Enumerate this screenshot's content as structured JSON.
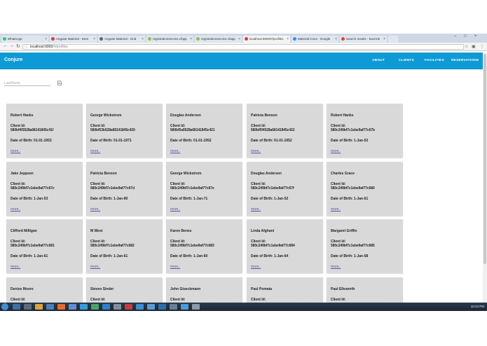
{
  "browser": {
    "tabs": [
      {
        "label": "WhatsApp",
        "color": "#25d366",
        "active": false
      },
      {
        "label": "Angular Material - Dem",
        "color": "#e53935",
        "active": false
      },
      {
        "label": "Angular Material - Grid",
        "color": "#666666",
        "active": false
      },
      {
        "label": "registrationservice.cfapp",
        "color": "#8bc34a",
        "active": false
      },
      {
        "label": "registrationservice.cfapp",
        "color": "#8bc34a",
        "active": false
      },
      {
        "label": "localhost:9000/#/profiles",
        "color": "#e53935",
        "active": true
      },
      {
        "label": "Material icons - Google",
        "color": "#4285f4",
        "active": false
      },
      {
        "label": "Search results - kuenzle",
        "color": "#ea4335",
        "active": false
      }
    ],
    "url_host": "localhost:9000",
    "url_path": "/#/profiles"
  },
  "app": {
    "brand": "Conjure",
    "nav": [
      "ABOUT",
      "CLIENTS",
      "FACILITIES",
      "RESERVATIONS"
    ]
  },
  "search": {
    "placeholder": "LastName"
  },
  "labels": {
    "client_id": "Client Id:",
    "dob_prefix": "Date of Birth: ",
    "more": "more.."
  },
  "profiles": [
    {
      "name": "Robert Hanks",
      "id": "580bf4f3528a68141845c41f",
      "dob": "01-01-1953"
    },
    {
      "name": "George Wickstrom",
      "id": "580bf53b528a68141845c420",
      "dob": "01-01-1971"
    },
    {
      "name": "Douglas Andersen",
      "id": "580bf5a9528a68141845c421",
      "dob": "01-01-1952"
    },
    {
      "name": "Patricia Benson",
      "id": "580bf5f4528a68141845c422",
      "dob": "01-01-1952"
    },
    {
      "name": "Robert Hanks",
      "id": "580c249bf7c1ebe9af77c67b",
      "dob": "1-Jan-53"
    },
    {
      "name": "Jake Jeppsen",
      "id": "580c249bf7c1ebe9af77c67c",
      "dob": "1-Jan-53"
    },
    {
      "name": "Patricia Benson",
      "id": "580c249bf7c1ebe9af77c67d",
      "dob": "1-Jan-80"
    },
    {
      "name": "George Wickstrom",
      "id": "580c249bf7c1ebe9af77c67e",
      "dob": "1-Jan-71"
    },
    {
      "name": "Douglas Andersen",
      "id": "580c249bf7c1ebe9af77c67f",
      "dob": "1-Jan-52"
    },
    {
      "name": "Charles Grace",
      "id": "580c249bf7c1ebe9af77c680",
      "dob": "1-Jan-61"
    },
    {
      "name": "Clifford Milligan",
      "id": "580c249bf7c1ebe9af77c681",
      "dob": "1-Jan-61"
    },
    {
      "name": "M West",
      "id": "580c249bf7c1ebe9af77c682",
      "dob": "1-Jan-61"
    },
    {
      "name": "Karen Benes",
      "id": "580c249bf7c1ebe9af77c683",
      "dob": "1-Jan-60"
    },
    {
      "name": "Linda Afghani",
      "id": "580c249bf7c1ebe9af77c684",
      "dob": "1-Jan-64"
    },
    {
      "name": "Margaret Griffin",
      "id": "580c249bf7c1ebe9af77c685",
      "dob": "1-Jan-58"
    },
    {
      "name": "Denise Moore",
      "id": "",
      "dob": ""
    },
    {
      "name": "Steven Sinder",
      "id": "",
      "dob": ""
    },
    {
      "name": "John Glueckmann",
      "id": "",
      "dob": ""
    },
    {
      "name": "Paul Pomata",
      "id": "",
      "dob": ""
    },
    {
      "name": "Paul Ellsworth",
      "id": "",
      "dob": ""
    }
  ],
  "taskbar": {
    "clock": "10:43 PM"
  },
  "colors": {
    "appbar": "#0e9ad4",
    "card": "#d9d9d9",
    "link": "#6a4aa8"
  }
}
